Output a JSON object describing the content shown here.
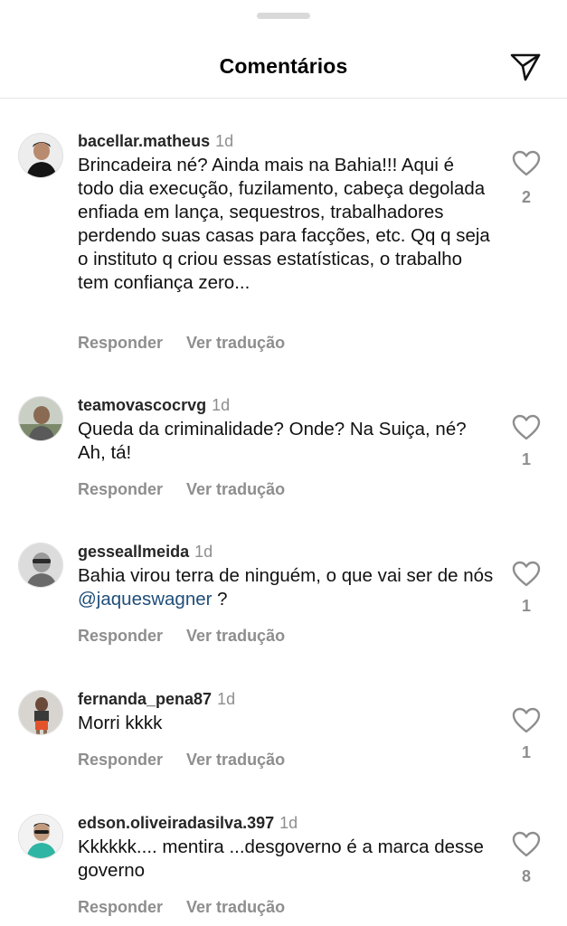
{
  "header": {
    "title": "Comentários"
  },
  "comments": [
    {
      "username": "bacellar.matheus",
      "time": "1d",
      "text": "Brincadeira né? Ainda mais na Bahia!!! Aqui é todo dia execução, fuzilamento, cabeça degolada enfiada em lança, sequestros, trabalhadores perdendo suas casas para facções, etc. Qq q seja o instituto q criou essas estatísticas, o trabalho tem confiança zero...",
      "likes": "2",
      "reply_label": "Responder",
      "translate_label": "Ver tradução"
    },
    {
      "username": "teamovascocrvg",
      "time": "1d",
      "text": "Queda da criminalidade? Onde? Na Suiça, né? Ah, tá!",
      "likes": "1",
      "reply_label": "Responder",
      "translate_label": "Ver tradução"
    },
    {
      "username": "gesseallmeida",
      "time": "1d",
      "text_before": "Bahia virou terra de ninguém, o que vai ser de nós ",
      "mention": "@jaqueswagner",
      "text_after": " ?",
      "likes": "1",
      "reply_label": "Responder",
      "translate_label": "Ver tradução"
    },
    {
      "username": "fernanda_pena87",
      "time": "1d",
      "text": "Morri kkkk",
      "likes": "1",
      "reply_label": "Responder",
      "translate_label": "Ver tradução"
    },
    {
      "username": "edson.oliveiradasilva.397",
      "time": "1d",
      "text": "Kkkkkk.... mentira ...desgoverno é a marca desse governo",
      "likes": "8",
      "reply_label": "Responder",
      "translate_label": "Ver tradução"
    }
  ],
  "icons": {
    "share": "paper-plane-icon",
    "like": "heart-outline-icon"
  },
  "colors": {
    "username": "#262626",
    "muted": "#8e8e8e",
    "mention": "#1f4e79"
  }
}
